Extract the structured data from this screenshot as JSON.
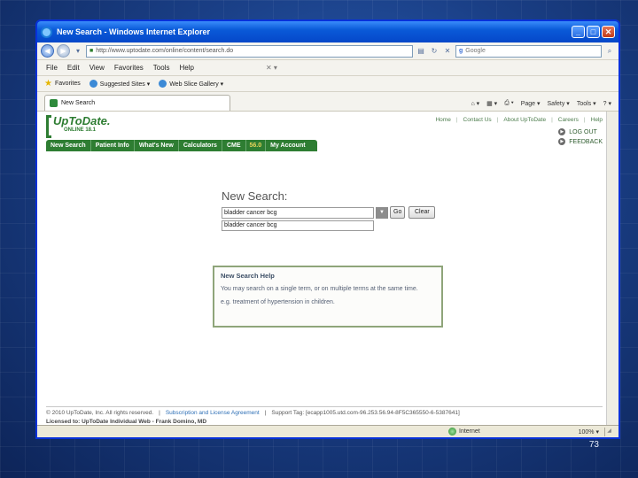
{
  "slide": {
    "number": "73"
  },
  "window": {
    "title": "New Search - Windows Internet Explorer"
  },
  "address": {
    "url": "http://www.uptodate.com/online/content/search.do",
    "search_placeholder": "Google"
  },
  "menu": {
    "items": [
      "File",
      "Edit",
      "View",
      "Favorites",
      "Tools",
      "Help"
    ]
  },
  "favorites": {
    "label": "Favorites",
    "items": [
      "Suggested Sites ▾",
      "Web Slice Gallery ▾"
    ]
  },
  "tab": {
    "label": "New Search"
  },
  "commandbar": {
    "items": [
      "Page ▾",
      "Safety ▾",
      "Tools ▾"
    ]
  },
  "utd": {
    "logo_word": "UpToDate.",
    "edition": "ONLINE 18.1",
    "top_links": [
      "Home",
      "Contact Us",
      "About UpToDate",
      "Careers",
      "Help"
    ],
    "account_links": [
      "LOG OUT",
      "FEEDBACK"
    ],
    "nav": [
      "New Search",
      "Patient Info",
      "What's New",
      "Calculators",
      "CME",
      "56.0",
      "My Account"
    ]
  },
  "search": {
    "title": "New Search:",
    "query": "bladder cancer bcg",
    "go_label": "Go",
    "clear_label": "Clear",
    "suggestion": "bladder cancer bcg"
  },
  "help": {
    "title": "New Search Help",
    "text": "You may search on a single term, or on multiple terms at the same time.",
    "example": "e.g. treatment of hypertension in children."
  },
  "footer": {
    "copyright": "© 2010 UpToDate, Inc. All rights reserved.",
    "separator": "|",
    "agreement_link": "Subscription and License Agreement",
    "support_tag": "Support Tag: [ecapp1005.utd.com-96.253.56.94-8F5C365550-6-5387641]",
    "licensed_to": "Licensed to: UpToDate Individual Web - Frank Domino, MD"
  },
  "status": {
    "zone": "Internet",
    "zoom": "100% ▾"
  }
}
